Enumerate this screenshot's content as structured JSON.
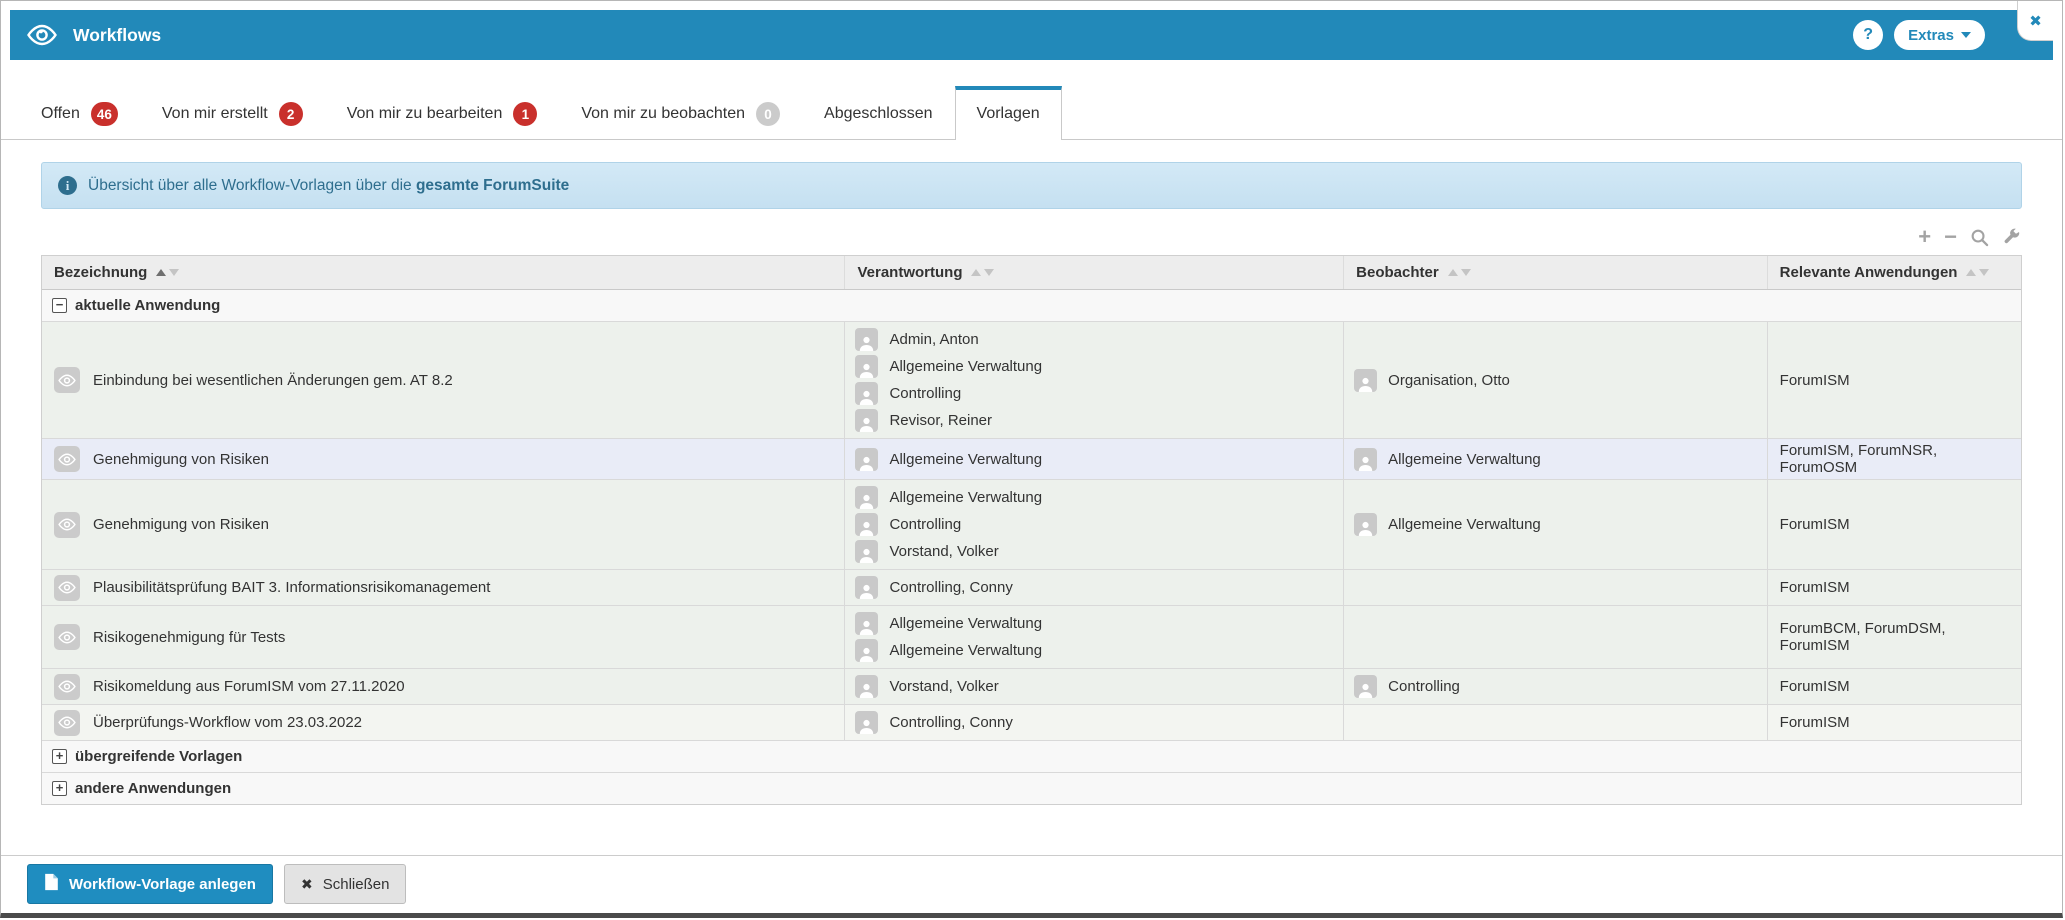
{
  "header": {
    "title": "Workflows",
    "help_label": "?",
    "extras_label": "Extras",
    "close_glyph": "✖"
  },
  "tabs": [
    {
      "label": "Offen",
      "badge": "46",
      "badge_color": "red",
      "active": false
    },
    {
      "label": "Von mir erstellt",
      "badge": "2",
      "badge_color": "red",
      "active": false
    },
    {
      "label": "Von mir zu bearbeiten",
      "badge": "1",
      "badge_color": "red",
      "active": false
    },
    {
      "label": "Von mir zu beobachten",
      "badge": "0",
      "badge_color": "gray",
      "active": false
    },
    {
      "label": "Abgeschlossen",
      "badge": null,
      "active": false
    },
    {
      "label": "Vorlagen",
      "badge": null,
      "active": true
    }
  ],
  "info_banner": {
    "icon_glyph": "i",
    "text_prefix": "Übersicht über alle Workflow-Vorlagen über die ",
    "text_bold": "gesamte ForumSuite"
  },
  "toolbar": {
    "icons": [
      {
        "name": "expand-all-icon",
        "glyph": "+"
      },
      {
        "name": "collapse-all-icon",
        "glyph": "−"
      },
      {
        "name": "search-icon",
        "glyph": "magnifier"
      },
      {
        "name": "settings-icon",
        "glyph": "wrench"
      }
    ]
  },
  "table": {
    "columns": [
      {
        "label": "Bezeichnung",
        "sort": "asc"
      },
      {
        "label": "Verantwortung",
        "sort": null
      },
      {
        "label": "Beobachter",
        "sort": null
      },
      {
        "label": "Relevante Anwendungen",
        "sort": null
      }
    ],
    "groups": [
      {
        "label": "aktuelle Anwendung",
        "expanded": true,
        "rows": [
          {
            "bezeichnung": "Einbindung bei wesentlichen Änderungen gem. AT 8.2",
            "verantwortung": [
              "Admin, Anton",
              "Allgemeine Verwaltung",
              "Controlling",
              "Revisor, Reiner"
            ],
            "beobachter": [
              "Organisation, Otto"
            ],
            "anwendungen": "ForumISM",
            "selected": false,
            "light": false
          },
          {
            "bezeichnung": "Genehmigung von Risiken",
            "verantwortung": [
              "Allgemeine Verwaltung"
            ],
            "beobachter": [
              "Allgemeine Verwaltung"
            ],
            "anwendungen": "ForumISM, ForumNSR, ForumOSM",
            "selected": true,
            "light": false
          },
          {
            "bezeichnung": "Genehmigung von Risiken",
            "verantwortung": [
              "Allgemeine Verwaltung",
              "Controlling",
              "Vorstand, Volker"
            ],
            "beobachter": [
              "Allgemeine Verwaltung"
            ],
            "anwendungen": "ForumISM",
            "selected": false,
            "light": false
          },
          {
            "bezeichnung": "Plausibilitätsprüfung BAIT 3. Informationsrisikomanagement",
            "verantwortung": [
              "Controlling, Conny"
            ],
            "beobachter": [],
            "anwendungen": "ForumISM",
            "selected": false,
            "light": false
          },
          {
            "bezeichnung": "Risikogenehmigung für Tests",
            "verantwortung": [
              "Allgemeine Verwaltung",
              "Allgemeine Verwaltung"
            ],
            "beobachter": [],
            "anwendungen": "ForumBCM, ForumDSM, ForumISM",
            "selected": false,
            "light": false
          },
          {
            "bezeichnung": "Risikomeldung aus ForumISM vom 27.11.2020",
            "verantwortung": [
              "Vorstand, Volker"
            ],
            "beobachter": [
              "Controlling"
            ],
            "anwendungen": "ForumISM",
            "selected": false,
            "light": false
          },
          {
            "bezeichnung": "Überprüfungs-Workflow vom 23.03.2022",
            "verantwortung": [
              "Controlling, Conny"
            ],
            "beobachter": [],
            "anwendungen": "ForumISM",
            "selected": false,
            "light": true
          }
        ]
      },
      {
        "label": "übergreifende Vorlagen",
        "expanded": false,
        "rows": []
      },
      {
        "label": "andere Anwendungen",
        "expanded": false,
        "rows": []
      }
    ]
  },
  "footer": {
    "primary_label": "Workflow-Vorlage anlegen",
    "secondary_label": "Schließen",
    "secondary_glyph": "✖"
  },
  "colors": {
    "accent_blue": "#2289b9",
    "badge_red": "#c9302c",
    "badge_gray": "#cbcbcb",
    "banner_text": "#2e6e8e",
    "row_green": "#edf1ec",
    "row_selected": "#e9ecf7"
  }
}
